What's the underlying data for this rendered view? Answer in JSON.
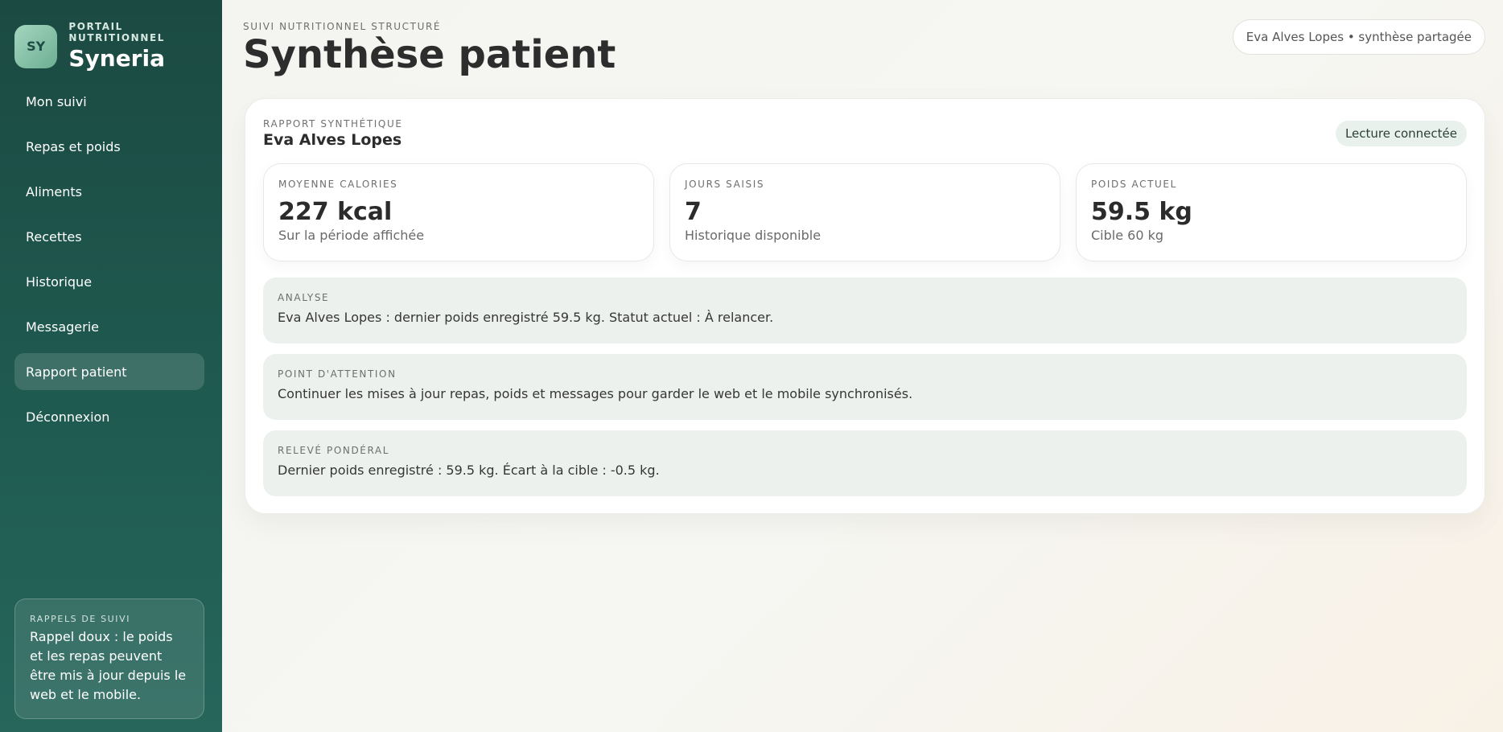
{
  "sidebar": {
    "brand": {
      "logo_text": "SY",
      "kicker": "PORTAIL NUTRITIONNEL",
      "name": "Syneria"
    },
    "items": [
      {
        "label": "Mon suivi",
        "active": false
      },
      {
        "label": "Repas et poids",
        "active": false
      },
      {
        "label": "Aliments",
        "active": false
      },
      {
        "label": "Recettes",
        "active": false
      },
      {
        "label": "Historique",
        "active": false
      },
      {
        "label": "Messagerie",
        "active": false
      },
      {
        "label": "Rapport patient",
        "active": true
      },
      {
        "label": "Déconnexion",
        "active": false
      }
    ],
    "reminder": {
      "kicker": "RAPPELS DE SUIVI",
      "text": "Rappel doux : le poids et les repas peuvent être mis à jour depuis le web et le mobile."
    }
  },
  "header": {
    "kicker": "SUIVI NUTRITIONNEL STRUCTURÉ",
    "title": "Synthèse patient",
    "session_label": "Eva Alves Lopes • synthèse partagée"
  },
  "report": {
    "kicker": "RAPPORT SYNTHÉTIQUE",
    "patient_name": "Eva Alves Lopes",
    "badge": "Lecture connectée",
    "stats": [
      {
        "label": "MOYENNE CALORIES",
        "value": "227 kcal",
        "sub": "Sur la période affichée"
      },
      {
        "label": "JOURS SAISIS",
        "value": "7",
        "sub": "Historique disponible"
      },
      {
        "label": "POIDS ACTUEL",
        "value": "59.5 kg",
        "sub": "Cible 60 kg"
      }
    ],
    "notes": [
      {
        "label": "ANALYSE",
        "text": "Eva Alves Lopes : dernier poids enregistré 59.5 kg. Statut actuel : À relancer."
      },
      {
        "label": "POINT D'ATTENTION",
        "text": "Continuer les mises à jour repas, poids et messages pour garder le web et le mobile synchronisés."
      },
      {
        "label": "RELEVÉ PONDÉRAL",
        "text": "Dernier poids enregistré : 59.5 kg. Écart à la cible : -0.5 kg."
      }
    ]
  },
  "colors": {
    "sidebar": "#1f5a50",
    "note_bg": "#edf1ed",
    "badge_bg": "#e8f1ec",
    "logo": "#8fc7ad"
  }
}
